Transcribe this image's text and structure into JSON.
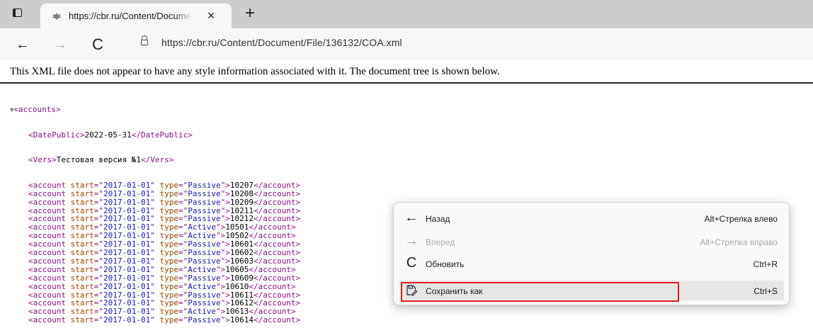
{
  "tab": {
    "title": "https://cbr.ru/Content/Documen",
    "close_glyph": "×",
    "new_tab_glyph": "+"
  },
  "toolbar": {
    "back_glyph": "←",
    "forward_glyph": "→",
    "reload_glyph": "C",
    "url": "https://cbr.ru/Content/Document/File/136132/COA.xml"
  },
  "page": {
    "info_text": "This XML file does not appear to have any style information associated with it. The document tree is shown below."
  },
  "xml": {
    "toggle": "▼",
    "root": "accounts",
    "date_public": "2022-05-31",
    "vers": "Тестовая версия №1",
    "accounts": [
      {
        "start": "2017-01-01",
        "type": "Passive",
        "value": "10207"
      },
      {
        "start": "2017-01-01",
        "type": "Passive",
        "value": "10208"
      },
      {
        "start": "2017-01-01",
        "type": "Passive",
        "value": "10209"
      },
      {
        "start": "2017-01-01",
        "type": "Passive",
        "value": "10211"
      },
      {
        "start": "2017-01-01",
        "type": "Passive",
        "value": "10212"
      },
      {
        "start": "2017-01-01",
        "type": "Active",
        "value": "10501"
      },
      {
        "start": "2017-01-01",
        "type": "Active",
        "value": "10502"
      },
      {
        "start": "2017-01-01",
        "type": "Passive",
        "value": "10601"
      },
      {
        "start": "2017-01-01",
        "type": "Passive",
        "value": "10602"
      },
      {
        "start": "2017-01-01",
        "type": "Passive",
        "value": "10603"
      },
      {
        "start": "2017-01-01",
        "type": "Active",
        "value": "10605"
      },
      {
        "start": "2017-01-01",
        "type": "Passive",
        "value": "10609"
      },
      {
        "start": "2017-01-01",
        "type": "Active",
        "value": "10610"
      },
      {
        "start": "2017-01-01",
        "type": "Passive",
        "value": "10611"
      },
      {
        "start": "2017-01-01",
        "type": "Passive",
        "value": "10612"
      },
      {
        "start": "2017-01-01",
        "type": "Active",
        "value": "10613"
      },
      {
        "start": "2017-01-01",
        "type": "Passive",
        "value": "10614"
      }
    ]
  },
  "context_menu": {
    "items": [
      {
        "icon": "arrow-left-icon",
        "glyph": "←",
        "label": "Назад",
        "shortcut": "Alt+Стрелка влево",
        "enabled": true
      },
      {
        "icon": "arrow-right-icon",
        "glyph": "→",
        "label": "Вперед",
        "shortcut": "Alt+Стрелка вправо",
        "enabled": false
      },
      {
        "icon": "refresh-icon",
        "glyph": "C",
        "label": "Обновить",
        "shortcut": "Ctrl+R",
        "enabled": true
      },
      {
        "icon": "save-as-icon",
        "glyph": "",
        "label": "Сохранить как",
        "shortcut": "Ctrl+S",
        "enabled": true
      }
    ],
    "highlight_color": "#e02020"
  }
}
